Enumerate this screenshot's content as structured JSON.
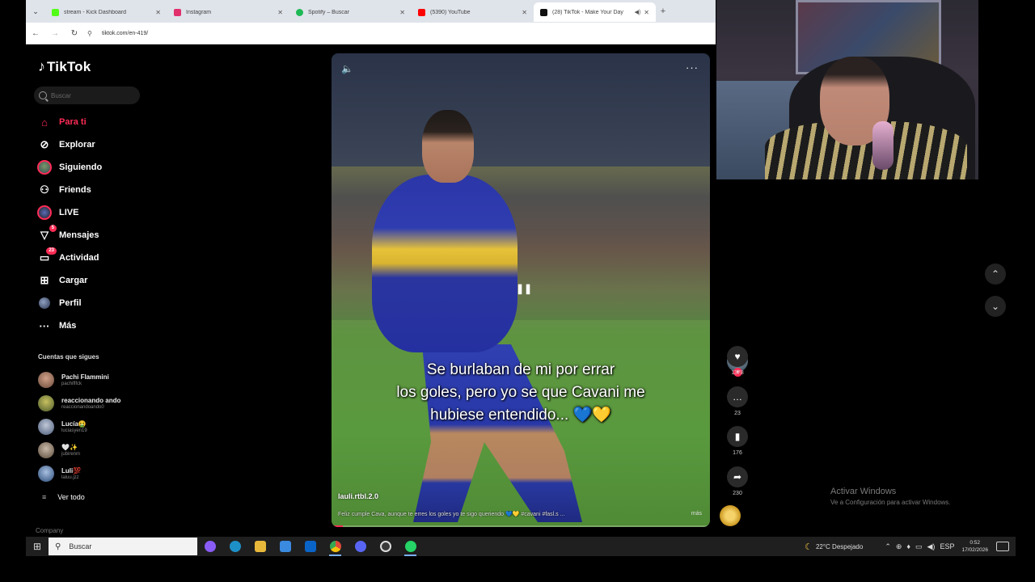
{
  "browser": {
    "tabs": [
      {
        "title": "stream - Kick Dashboard",
        "color": "#53fc18",
        "active": false
      },
      {
        "title": "Instagram",
        "color": "#e1306c",
        "active": false
      },
      {
        "title": "Spotify – Buscar",
        "color": "#1db954",
        "active": false
      },
      {
        "title": "(5390) YouTube",
        "color": "#ff0000",
        "active": false
      },
      {
        "title": "(28) TikTok - Make Your Day",
        "color": "#111111",
        "active": true
      }
    ],
    "new_tab": "+",
    "url": "tiktok.com/en-419/"
  },
  "tiktok": {
    "logo": "TikTok",
    "search_placeholder": "Buscar",
    "nav": [
      {
        "label": "Para ti",
        "icon": "home-icon"
      },
      {
        "label": "Explorar",
        "icon": "compass-icon"
      },
      {
        "label": "Siguiendo",
        "icon": "following-avatar-icon"
      },
      {
        "label": "Friends",
        "icon": "friends-icon"
      },
      {
        "label": "LIVE",
        "icon": "live-icon"
      },
      {
        "label": "Mensajes",
        "icon": "send-icon",
        "badge": "5"
      },
      {
        "label": "Actividad",
        "icon": "activity-icon",
        "badge": "23"
      },
      {
        "label": "Cargar",
        "icon": "upload-icon"
      },
      {
        "label": "Perfil",
        "icon": "profile-icon"
      },
      {
        "label": "Más",
        "icon": "more-icon"
      }
    ],
    "following_title": "Cuentas que sigues",
    "following": [
      {
        "name": "Pachi Flammini",
        "handle": "pachiflfck",
        "color": "#8a6a5a"
      },
      {
        "name": "reaccionando ando",
        "handle": "reaccionandoando0",
        "color": "#6a7a4a"
      },
      {
        "name": "Lucía🤮",
        "handle": "luciasyen19",
        "color": "#7a8aa0"
      },
      {
        "name": "🤍✨",
        "handle": "jubirenm",
        "color": "#9a8a7a"
      },
      {
        "name": "Luli💯",
        "handle": "laluu.jzz",
        "color": "#5a7aa0"
      }
    ],
    "see_all": "Ver todo",
    "company": "Company",
    "video": {
      "caption_lines": [
        "Se burlaban de mi por errar",
        "los goles, pero yo se que Cavani me",
        "hubiese entendido... 💙💛"
      ],
      "author": "lauli.rtbl.2.0",
      "description": "Feliz cumple Cava, aunque te erres los goles yo te sigo queriendo 💙💛 #cavani #fasl.s ...",
      "more": "más",
      "progress": 0.03
    },
    "actions": {
      "likes": "1378",
      "comments": "23",
      "saves": "176",
      "shares": "230"
    }
  },
  "watermark": {
    "line1": "Activar Windows",
    "line2": "Ve a Configuración para activar Windows."
  },
  "taskbar": {
    "search_placeholder": "Buscar",
    "apps": [
      {
        "name": "copilot",
        "color": "#8a5cf6"
      },
      {
        "name": "edge",
        "color": "#1e90c8"
      },
      {
        "name": "file-explorer",
        "color": "#e8b83a"
      },
      {
        "name": "store",
        "color": "#3a8ae0"
      },
      {
        "name": "outlook",
        "color": "#0a64c8"
      },
      {
        "name": "chrome",
        "color": "#e04a3a",
        "active": true
      },
      {
        "name": "discord",
        "color": "#5865f2"
      },
      {
        "name": "obs",
        "color": "#3a3a3a"
      },
      {
        "name": "whatsapp",
        "color": "#25d366",
        "active": true
      }
    ],
    "weather": "22°C  Despejado",
    "lang": "ESP",
    "time": "0:52",
    "date": "17/02/2026"
  }
}
